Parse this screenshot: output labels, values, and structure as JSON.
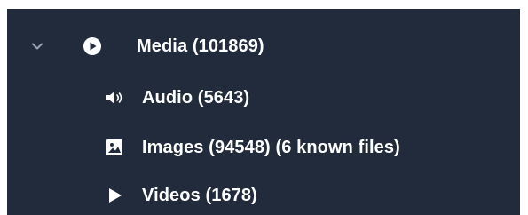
{
  "tree": {
    "parent": {
      "label": "Media (101869)",
      "icon": "play-circle-icon",
      "expanded": true
    },
    "children": [
      {
        "label": "Audio (5643)",
        "icon": "speaker-icon"
      },
      {
        "label": "Images (94548)  (6 known files)",
        "icon": "image-icon"
      },
      {
        "label": "Videos (1678)",
        "icon": "play-icon"
      }
    ]
  },
  "colors": {
    "panel_background": "#222b3b",
    "text": "#ffffff",
    "chevron": "#9aa3b2"
  }
}
